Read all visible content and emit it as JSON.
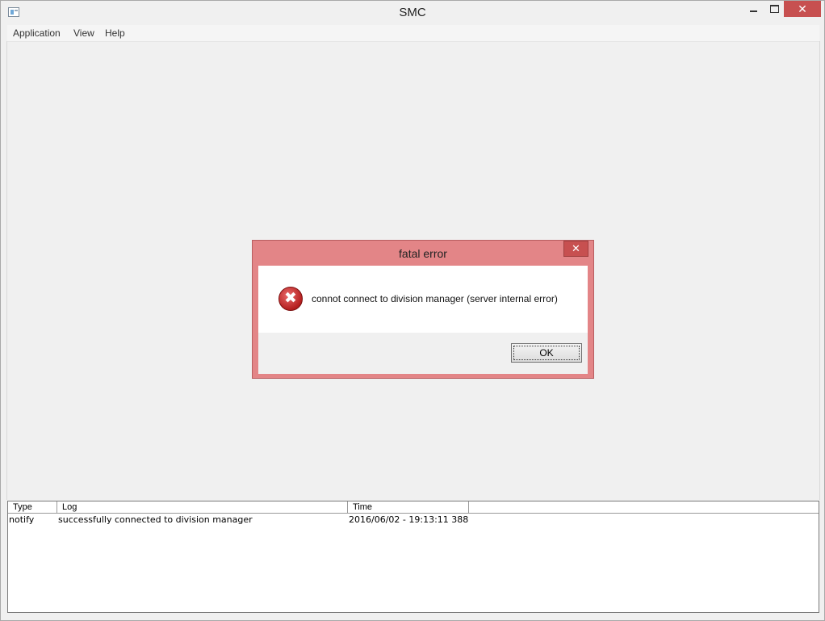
{
  "window": {
    "title": "SMC",
    "close_glyph": "✕",
    "icon": "app-window-icon"
  },
  "menu": {
    "items": [
      {
        "label": "Application"
      },
      {
        "label": "View"
      },
      {
        "label": "Help"
      }
    ]
  },
  "log": {
    "columns": [
      "Type",
      "Log",
      "Time"
    ],
    "rows": [
      {
        "type": "notify",
        "log": "successfully connected to division manager",
        "time": "2016/06/02 - 19:13:11 388"
      }
    ]
  },
  "dialog": {
    "title": "fatal error",
    "close_glyph": "✕",
    "icon": "error-icon",
    "icon_glyph": "✖",
    "message": "connot connect to division manager (server internal error)",
    "ok_label": "OK",
    "accent_color": "#e38587"
  }
}
